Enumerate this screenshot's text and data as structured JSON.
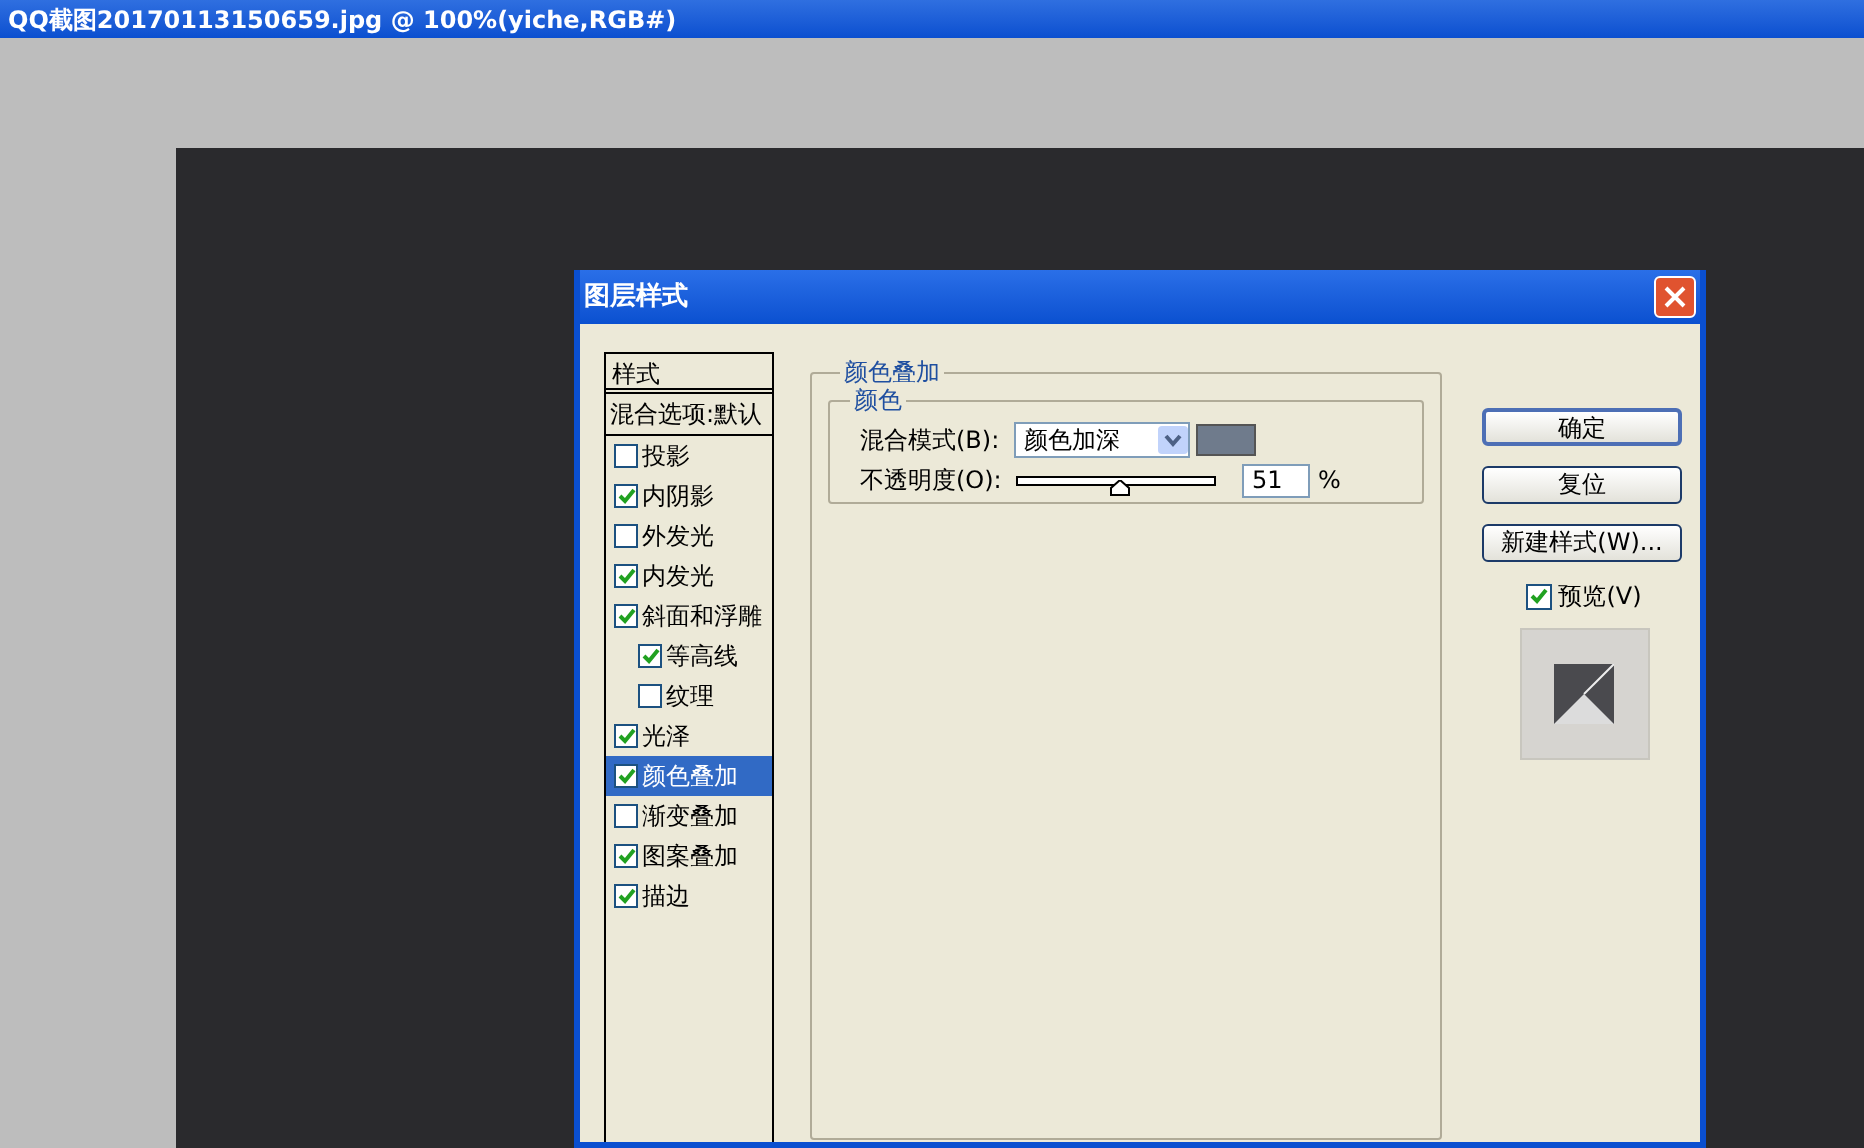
{
  "window": {
    "title": "QQ截图20170113150659.jpg @ 100%(yiche,RGB#)"
  },
  "dialog": {
    "title": "图层样式",
    "styles_header": "样式",
    "blending_options": "混合选项:默认",
    "styles": [
      {
        "label": "投影",
        "checked": false,
        "selected": false
      },
      {
        "label": "内阴影",
        "checked": true,
        "selected": false
      },
      {
        "label": "外发光",
        "checked": false,
        "selected": false
      },
      {
        "label": "内发光",
        "checked": true,
        "selected": false
      },
      {
        "label": "斜面和浮雕",
        "checked": true,
        "selected": false,
        "children": [
          {
            "label": "等高线",
            "checked": true,
            "selected": false
          },
          {
            "label": "纹理",
            "checked": false,
            "selected": false
          }
        ]
      },
      {
        "label": "光泽",
        "checked": true,
        "selected": false
      },
      {
        "label": "颜色叠加",
        "checked": true,
        "selected": true
      },
      {
        "label": "渐变叠加",
        "checked": false,
        "selected": false
      },
      {
        "label": "图案叠加",
        "checked": true,
        "selected": false
      },
      {
        "label": "描边",
        "checked": true,
        "selected": false
      }
    ],
    "panel": {
      "group_title": "颜色叠加",
      "subgroup_title": "颜色",
      "blend_mode": {
        "label": "混合模式(B):",
        "value": "颜色加深",
        "color": "#6f7b8c"
      },
      "opacity": {
        "label": "不透明度(O):",
        "level": 0.51,
        "reading": "51",
        "unit": "%"
      }
    },
    "buttons": [
      {
        "label": "确定",
        "default": true
      },
      {
        "label": "复位",
        "default": false
      },
      {
        "label": "新建样式(W)...",
        "default": false
      }
    ],
    "preview": {
      "label": "预览(V)",
      "checked": true
    }
  }
}
